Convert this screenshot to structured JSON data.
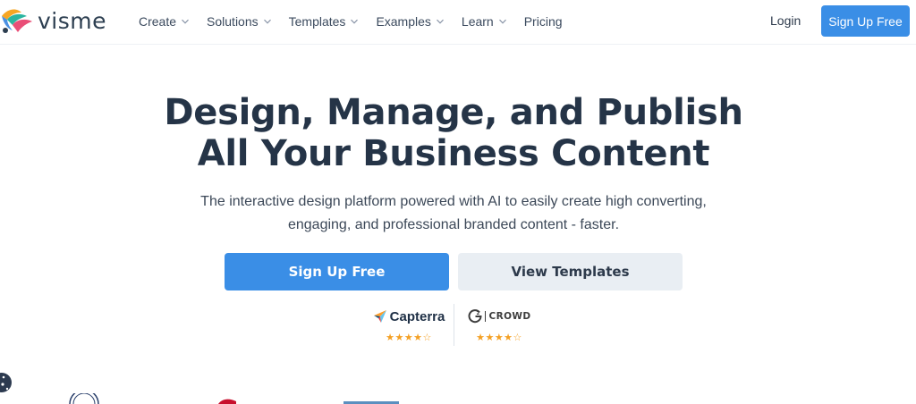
{
  "header": {
    "logo_text": "visme",
    "nav": [
      {
        "label": "Create",
        "has_dropdown": true
      },
      {
        "label": "Solutions",
        "has_dropdown": true
      },
      {
        "label": "Templates",
        "has_dropdown": true
      },
      {
        "label": "Examples",
        "has_dropdown": true
      },
      {
        "label": "Learn",
        "has_dropdown": true
      },
      {
        "label": "Pricing",
        "has_dropdown": false
      }
    ],
    "login_label": "Login",
    "signup_label": "Sign Up Free"
  },
  "hero": {
    "title_line1": "Design, Manage, and Publish",
    "title_line2": "All Your Business Content",
    "subtitle_line1": "The interactive design platform powered with AI to easily create high converting,",
    "subtitle_line2": "engaging, and professional branded content - faster.",
    "primary_cta": "Sign Up Free",
    "secondary_cta": "View Templates"
  },
  "ratings": {
    "capterra": {
      "name": "Capterra",
      "stars": "★★★★☆",
      "rating": 4.5
    },
    "g2": {
      "name": "CROWD",
      "stars": "★★★★☆",
      "rating": 4.5
    }
  },
  "colors": {
    "accent": "#3a8ee6",
    "heading": "#253447",
    "secondary_button": "#e9eef3",
    "star": "#f4a024"
  },
  "icons": {
    "chevron": "chevron-down-icon",
    "capterra": "capterra-logo-icon",
    "g2": "g2-logo-icon",
    "cookie": "cookie-icon"
  }
}
